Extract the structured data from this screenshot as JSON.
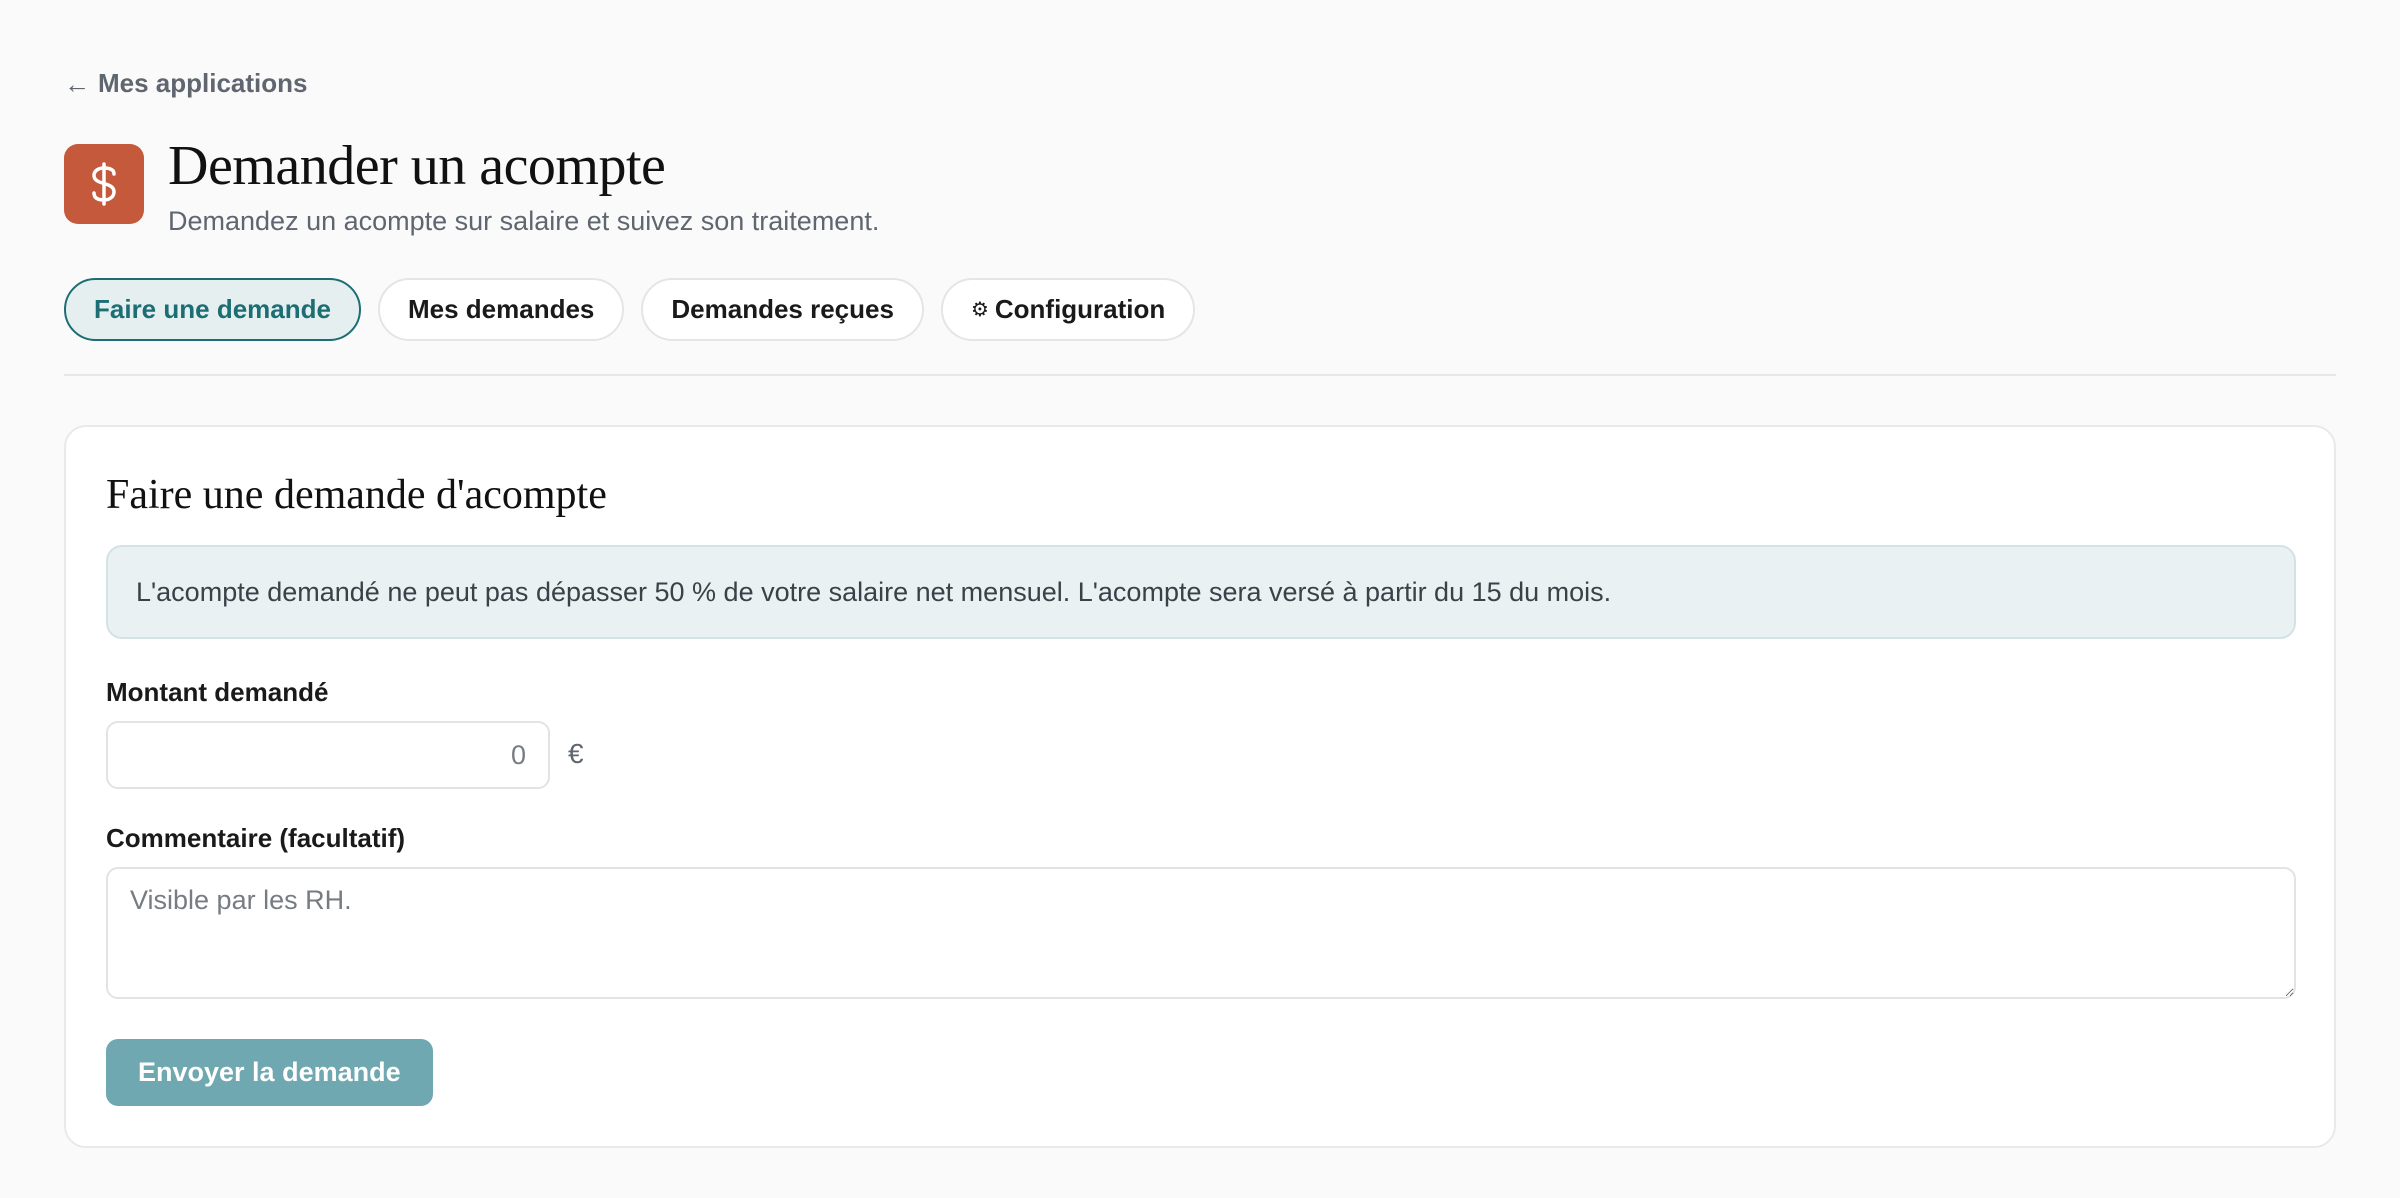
{
  "nav": {
    "back_label": "Mes applications",
    "back_icon": "arrow-left-icon"
  },
  "header": {
    "app_icon": "dollar-icon",
    "app_icon_color": "#c45a3b",
    "title": "Demander un acompte",
    "subtitle": "Demandez un acompte sur salaire et suivez son traitement."
  },
  "tabs": [
    {
      "label": "Faire une demande",
      "active": true
    },
    {
      "label": "Mes demandes",
      "active": false
    },
    {
      "label": "Demandes reçues",
      "active": false
    },
    {
      "label": "Configuration",
      "active": false,
      "icon": "gear-icon"
    }
  ],
  "form": {
    "title": "Faire une demande d'acompte",
    "info_text": "L'acompte demandé ne peut pas dépasser 50 % de votre salaire net mensuel. L'acompte sera versé à partir du 15 du mois.",
    "amount_label": "Montant demandé",
    "amount_placeholder": "0",
    "amount_value": "",
    "currency": "€",
    "comment_label": "Commentaire (facultatif)",
    "comment_placeholder": "Visible par les RH.",
    "comment_value": "",
    "submit_label": "Envoyer la demande"
  },
  "colors": {
    "accent": "#1c6d74",
    "active_tab_bg": "#e5eff0",
    "submit_bg": "#6fa8b0",
    "info_bg": "#e9f1f3"
  }
}
